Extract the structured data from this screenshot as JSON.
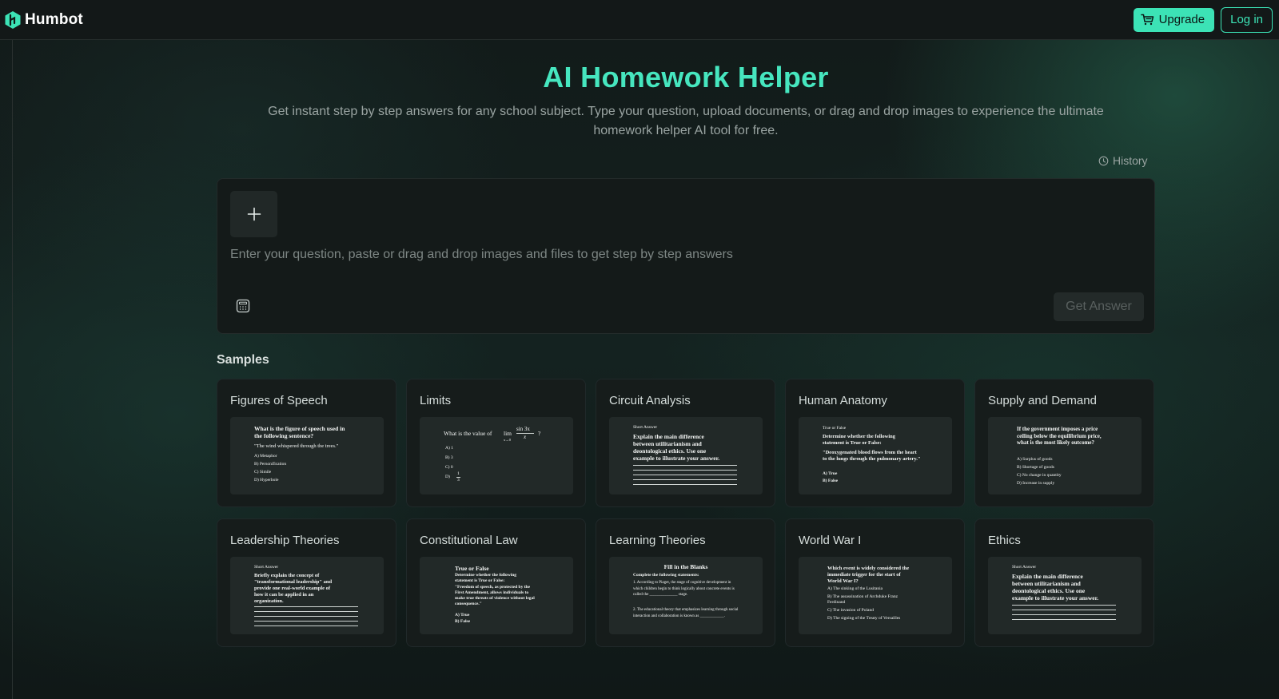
{
  "brand": {
    "name": "Humbot"
  },
  "nav": {
    "upgrade_label": "Upgrade",
    "login_label": "Log in"
  },
  "hero": {
    "title": "AI Homework Helper",
    "subtitle": "Get instant step by step answers for any school subject. Type your question, upload documents, or drag and drop images to experience the ultimate homework helper AI tool for free."
  },
  "history_label": "History",
  "composer": {
    "placeholder": "Enter your question, paste or drag and drop images and files to get step by step answers",
    "value": "",
    "submit_label": "Get Answer"
  },
  "samples": {
    "title": "Samples",
    "cards": [
      {
        "title": "Figures of Speech",
        "question": "What is the figure of speech used in the following sentence?",
        "quote": "\"The wind whispered through the trees.\"",
        "options": [
          "A)   Metaphor",
          "B)   Personification",
          "C)   Simile",
          "D)   Hyperbole"
        ]
      },
      {
        "title": "Limits",
        "question": "What is the value of",
        "limit_lhs": "lim",
        "limit_sub": "x→0",
        "limit_num": "sin 3x",
        "limit_den": "x",
        "question_mark": "?",
        "options": [
          "A)   1",
          "B)   3",
          "C)   0",
          "D)"
        ],
        "last_option_num": "1",
        "last_option_den": "3"
      },
      {
        "title": "Circuit Analysis",
        "kind": "Short Answer",
        "question": "Explain the main difference between utilitarianism and deontological ethics. Use one example to illustrate your answer."
      },
      {
        "title": "Human Anatomy",
        "kind": "True or False",
        "question": "Determine whether the following statement is True or False:",
        "quote": "\"Deoxygenated blood flows from the heart to the lungs through the pulmonary artery.\"",
        "options": [
          "A)   True",
          "B)   False"
        ]
      },
      {
        "title": "Supply and Demand",
        "question": "If the government imposes a price ceiling below the equilibrium price, what is the most likely outcome?",
        "options": [
          "A)   Surplus of goods",
          "B)   Shortage of goods",
          "C)   No change in quantity",
          "D)   Increase in supply"
        ]
      },
      {
        "title": "Leadership Theories",
        "kind": "Short Answer",
        "question": "Briefly explain the concept of \"transformational leadership\" and provide one real-world example of how it can be applied in an organization."
      },
      {
        "title": "Constitutional Law",
        "kind": "True or False",
        "question": "Determine whether the following statement is True or False:",
        "quote": "\"Freedom of speech, as protected by the First Amendment, allows individuals to make true threats of violence without legal consequence.\"",
        "options": [
          "A) True",
          "B) False"
        ]
      },
      {
        "title": "Learning Theories",
        "kind": "Fill in the Blanks",
        "question": "Complete the following statements:",
        "items": [
          "1.   According to Piaget, the stage of cognitive development in which children begin to think logically about concrete events is called the ______________ stage.",
          "2.   The educational theory that emphasizes learning through social interaction and collaboration is known as ____________."
        ]
      },
      {
        "title": "World War I",
        "question": "Which event is widely considered the immediate trigger for the start of World War I?",
        "options": [
          "A)   The sinking of the Lusitania",
          "B)   The assassination of Archduke Franz Ferdinand",
          "C)   The invasion of Poland",
          "D)   The signing of the Treaty of Versailles"
        ]
      },
      {
        "title": "Ethics",
        "kind": "Short Answer",
        "question": "Explain the main difference between utilitarianism and deontological ethics. Use one example to illustrate your answer."
      }
    ]
  },
  "colors": {
    "accent": "#3ce3b6",
    "title": "#46e6bf",
    "background": "#0f1615",
    "card": "#161c1b"
  },
  "icons": [
    "humbot-logo-icon",
    "cart-icon",
    "history-icon",
    "plus-icon",
    "calculator-icon"
  ]
}
